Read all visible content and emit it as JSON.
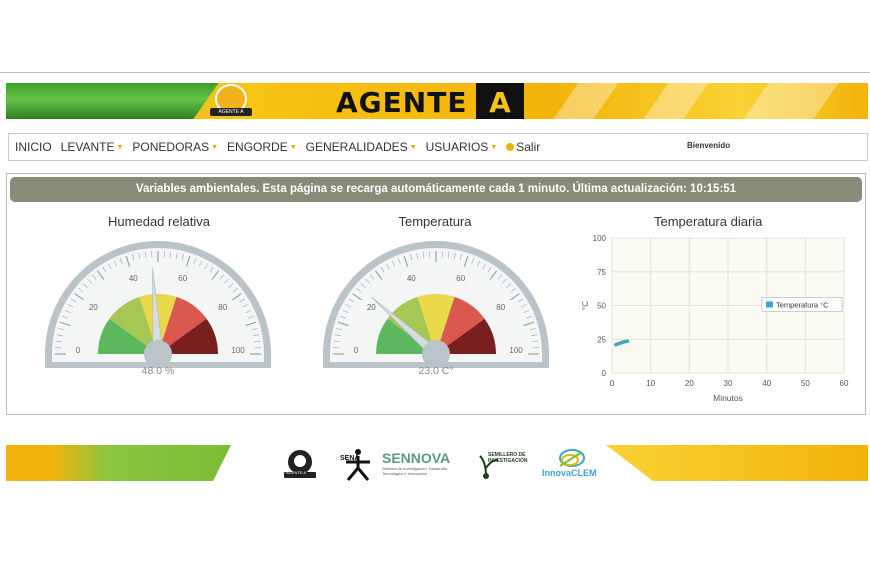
{
  "header": {
    "brand_word": "AGENTE",
    "brand_letter": "A",
    "badge_text": "AGENTE A"
  },
  "nav": {
    "items": [
      {
        "label": "INICIO",
        "dropdown": false
      },
      {
        "label": "LEVANTE",
        "dropdown": true
      },
      {
        "label": "PONEDORAS",
        "dropdown": true
      },
      {
        "label": "ENGORDE",
        "dropdown": true
      },
      {
        "label": "GENERALIDADES",
        "dropdown": true
      },
      {
        "label": "USUARIOS",
        "dropdown": true
      }
    ],
    "logout_label": "Salir",
    "welcome": "Bienvenido"
  },
  "panel": {
    "heading": "Variables ambientales. Esta página se recarga automáticamente cada 1 minuto. Última actualización: 10:15:51"
  },
  "gauges": [
    {
      "title": "Humedad relativa",
      "value": 48.0,
      "readout": "48.0 %",
      "ticks": [
        "0",
        "20",
        "40",
        "60",
        "80",
        "100"
      ]
    },
    {
      "title": "Temperatura",
      "value": 23.0,
      "readout": "23.0 C°",
      "ticks": [
        "0",
        "20",
        "40",
        "60",
        "80",
        "100"
      ]
    }
  ],
  "gauge_colors": [
    "#5cb85c",
    "#a6c754",
    "#e8d84a",
    "#d9594f",
    "#7a1f1f"
  ],
  "chart_data": {
    "type": "line",
    "title": "Temperatura diaria",
    "xlabel": "Minutos",
    "ylabel": "°C",
    "xlim": [
      0,
      60
    ],
    "ylim": [
      0,
      100
    ],
    "x_ticks": [
      "0",
      "10",
      "20",
      "30",
      "40",
      "50",
      "60"
    ],
    "y_ticks": [
      "0",
      "25",
      "50",
      "75",
      "100"
    ],
    "series": [
      {
        "name": "Temperatura °C",
        "color": "#3aa6c9",
        "x": [
          1,
          2,
          3,
          4
        ],
        "y": [
          21,
          22,
          23,
          23.5
        ]
      }
    ],
    "legend": "right",
    "grid": true
  },
  "footer": {
    "sena": "SENA",
    "sennova": "SENNOVA",
    "sennova_sub": "Sistema de Investigación, Desarrollo Tecnológico e Innovación",
    "semillero": "SEMILLERO DE INVESTIGACIÓN",
    "innova": "InnovaCLEM",
    "agente": "AGENTE A"
  }
}
